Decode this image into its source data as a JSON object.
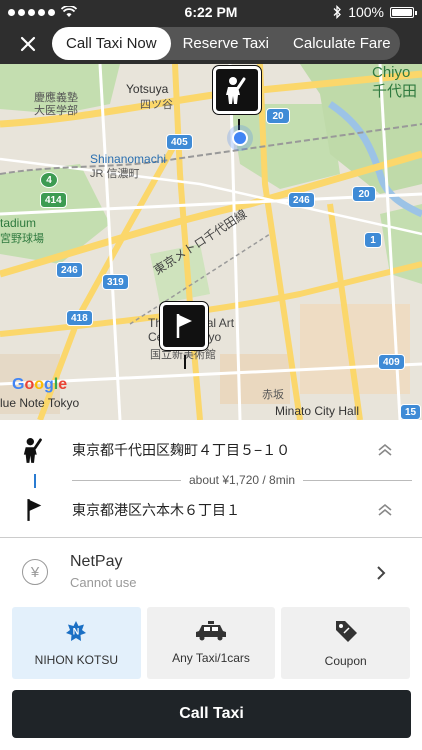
{
  "status_bar": {
    "time": "6:22 PM",
    "battery": "100%"
  },
  "nav": {
    "tabs": [
      {
        "label": "Call Taxi Now",
        "active": true
      },
      {
        "label": "Reserve Taxi",
        "active": false
      },
      {
        "label": "Calculate Fare",
        "active": false
      }
    ]
  },
  "map": {
    "labels": {
      "yotsuya": "Yotsuya",
      "yotsuya_jp": "四ツ谷",
      "keio_univ": "慶應義塾\n大医学部",
      "shinanomachi": "Shinanomachi",
      "shinanomachi_jp": "JR 信濃町",
      "chiyoda_en": "Chiyo",
      "chiyoda_jp": "千代田",
      "stadium": "tadium",
      "stadium_jp": "宮野球場",
      "metro_line": "東京メトロ千代田線",
      "art_center": "The National Art\nCenter, Tokyo",
      "art_center_jp": "国立新美術館",
      "blue_note": "lue Note Tokyo",
      "minato_city": "Minato City Hall",
      "akasaka": "赤坂"
    },
    "route_shields": [
      "405",
      "20",
      "414",
      "4",
      "246",
      "319",
      "418",
      "246",
      "1",
      "20",
      "409",
      "15"
    ],
    "google_logo": "Google"
  },
  "route": {
    "pickup": "東京都千代田区麹町４丁目５−１０",
    "destination": "東京都港区六本木６丁目１",
    "estimate": "about ¥1,720 / 8min"
  },
  "payment": {
    "name": "NetPay",
    "status": "Cannot use",
    "icon": "yen-icon"
  },
  "options": [
    {
      "label": "NIHON KOTSU",
      "icon": "nihon-kotsu-logo-icon",
      "selected": true
    },
    {
      "label": "Any Taxi/1cars",
      "icon": "taxi-icon",
      "selected": false
    },
    {
      "label": "Coupon",
      "icon": "coupon-tag-icon",
      "selected": false
    }
  ],
  "call_button": "Call Taxi",
  "colors": {
    "accent_blue": "#2a7bd1",
    "dark": "#1f2428",
    "selected_card": "#e3f0fb"
  }
}
